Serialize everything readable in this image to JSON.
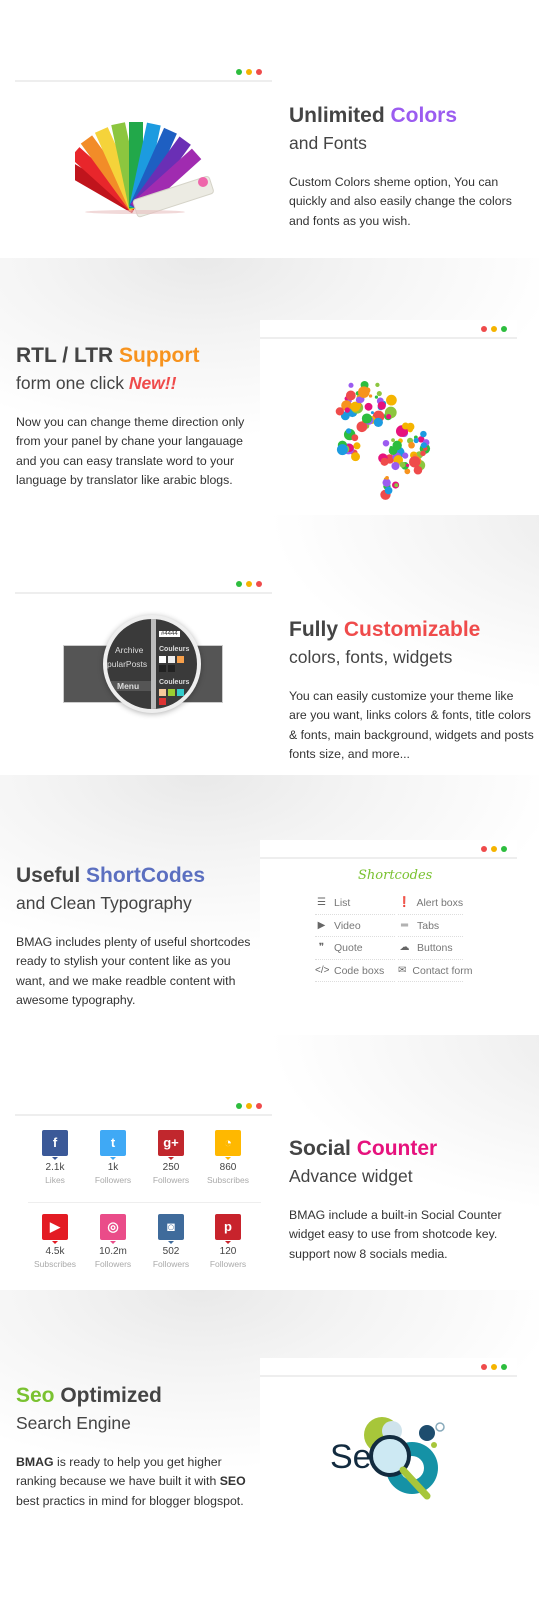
{
  "colors": {
    "dot_red": "#ef4b4b",
    "dot_yellow": "#f5b400",
    "dot_green": "#2dbd3e"
  },
  "sections": [
    {
      "title_plain": "Unlimited ",
      "title_accent": "Colors",
      "accent_color": "#9b5cf0",
      "subtitle": "and Fonts",
      "body": "Custom Colors sheme option, You can quickly and also easily change the colors and fonts as you wish.",
      "image": "color-fan"
    },
    {
      "title_plain": "RTL / LTR ",
      "title_accent": "Support",
      "accent_color": "#f7931e",
      "subtitle": "form one click ",
      "subtitle_badge": "New!!",
      "badge_color": "#ef4b4b",
      "body": "Now you can change theme direction only from your panel by chane your langauage and you can easy translate word to your language by translator like arabic blogs.",
      "image": "speech-bubbles"
    },
    {
      "title_plain": "Fully ",
      "title_accent": "Customizable",
      "accent_color": "#ef4b4b",
      "subtitle": "colors, fonts, widgets",
      "body": "You can easily customize your theme like are you want, links colors & fonts, title colors & fonts, main background, widgets and posts fonts size, and more...",
      "image": "customizer-magnifier"
    },
    {
      "title_plain": "Useful ",
      "title_accent": "ShortCodes",
      "accent_color": "#5b6fc0",
      "subtitle": "and Clean Typography",
      "body": "BMAG includes plenty of useful shortcodes ready to stylish your content like as you want, and we make readble content with awesome typography.",
      "image": "shortcodes-list"
    },
    {
      "title_plain": "Social ",
      "title_accent": "Counter",
      "accent_color": "#e6127d",
      "subtitle": "Advance widget",
      "body": "BMAG include a built-in Social Counter widget easy to use from shotcode key. support now 8 socials media.",
      "image": "social-counter"
    },
    {
      "title_accent": "Seo",
      "title_plain": " Optimized",
      "accent_color": "#7ac231",
      "subtitle": "Search Engine",
      "body_bold1": "BMAG",
      "body_part1": " is ready to help you get higher ranking because we have built it with ",
      "body_bold2": "SEO",
      "body_part2": " best practics in mind for blogger blogspot.",
      "image": "seo-gears"
    }
  ],
  "customizer": {
    "archive": "Archive",
    "popular": "pularPosts",
    "menu": "Menu",
    "colors1": "Couleurs",
    "colors2": "Couleurs",
    "hex": "#4444"
  },
  "shortcodes": {
    "title": "Shortcodes",
    "items": [
      {
        "label": "List",
        "icon": "list-icon",
        "glyph": "☰"
      },
      {
        "label": "Alert boxs",
        "icon": "alert-icon",
        "glyph": "❗"
      },
      {
        "label": "Video",
        "icon": "video-icon",
        "glyph": "▶"
      },
      {
        "label": "Tabs",
        "icon": "tabs-icon",
        "glyph": "═"
      },
      {
        "label": "Quote",
        "icon": "quote-icon",
        "glyph": "❞"
      },
      {
        "label": "Buttons",
        "icon": "cloud-upload-icon",
        "glyph": "☁"
      },
      {
        "label": "Code boxs",
        "icon": "code-icon",
        "glyph": "</>"
      },
      {
        "label": "Contact form",
        "icon": "envelope-icon",
        "glyph": "✉"
      }
    ]
  },
  "social": [
    {
      "network": "facebook",
      "glyph": "f",
      "color": "#3b5998",
      "count": "2.1k",
      "label": "Likes"
    },
    {
      "network": "twitter",
      "glyph": "t",
      "color": "#3fa9f5",
      "count": "1k",
      "label": "Followers"
    },
    {
      "network": "google-plus",
      "glyph": "g+",
      "color": "#c1272d",
      "count": "250",
      "label": "Followers"
    },
    {
      "network": "rss",
      "glyph": "◔",
      "color": "#ffb800",
      "count": "860",
      "label": "Subscribes"
    },
    {
      "network": "youtube",
      "glyph": "▶",
      "color": "#e31b23",
      "count": "4.5k",
      "label": "Subscribes"
    },
    {
      "network": "dribbble",
      "glyph": "◎",
      "color": "#ea4c89",
      "count": "10.2m",
      "label": "Followers"
    },
    {
      "network": "instagram",
      "glyph": "◙",
      "color": "#3f6b9b",
      "count": "502",
      "label": "Followers"
    },
    {
      "network": "pinterest",
      "glyph": "p",
      "color": "#c8232c",
      "count": "120",
      "label": "Followers"
    }
  ],
  "seo_logo_text": "Se"
}
